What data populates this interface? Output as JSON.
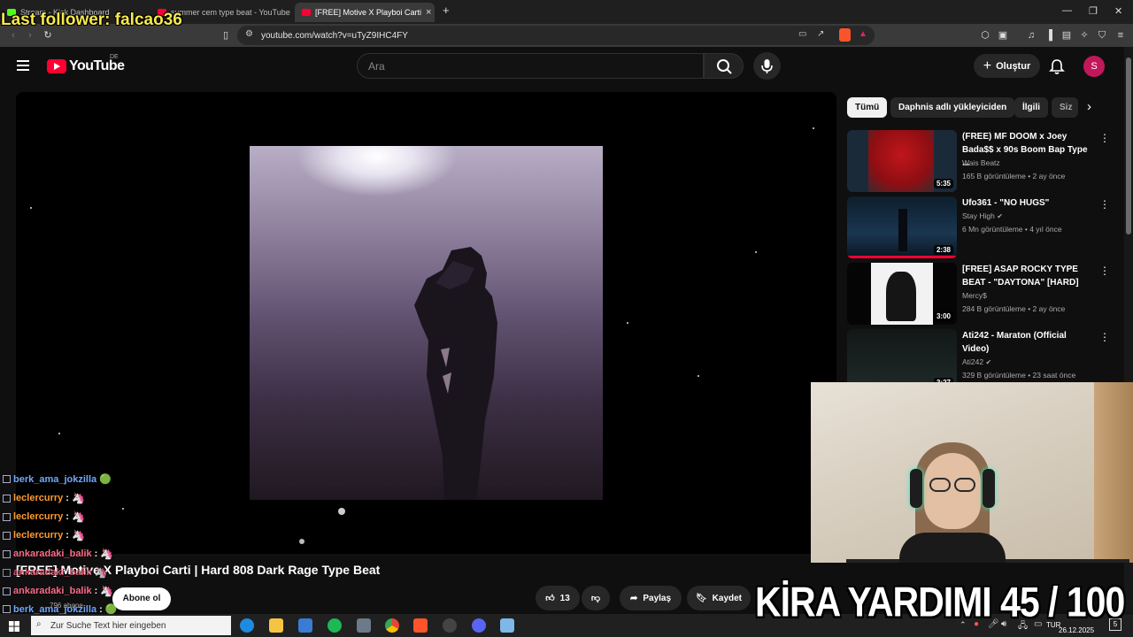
{
  "overlay": {
    "last_follower": "Last follower: falcao36",
    "goal": "KİRA YARDIMI 45 / 100"
  },
  "browser": {
    "tabs": [
      {
        "label": "Stream - Kick Dashboard",
        "color": "#53fc18"
      },
      {
        "label": "summer cem type beat - YouTube",
        "color": "#ff0033"
      },
      {
        "label": "[FREE] Motive X Playboi Carti",
        "color": "#ff0033"
      }
    ],
    "url": "youtube.com/watch?v=uTyZ9IHC4FY"
  },
  "youtube": {
    "logo_text": "YouTube",
    "country": "DE",
    "search_placeholder": "Ara",
    "create_label": "Oluştur",
    "avatar_letter": "S"
  },
  "video": {
    "title": "[FREE] Motive X Playboi Carti | Hard 808 Dark Rage Type Beat",
    "subscribe_label": "Abone ol",
    "subscriber_count": "796 abone",
    "likes": "13",
    "share_label": "Paylaş",
    "save_label": "Kaydet"
  },
  "chips": [
    "Tümü",
    "Daphnis adlı yükleyiciden",
    "İlgili",
    "Siz"
  ],
  "recommendations": [
    {
      "title": "(FREE) MF DOOM x Joey Bada$$ x 90s Boom Bap Type ...",
      "channel": "Wais Beatz",
      "meta": "165 B görüntüleme • 2 ay önce",
      "duration": "5:35",
      "verified": false
    },
    {
      "title": "Ufo361 - \"NO HUGS\"",
      "channel": "Stay High",
      "meta": "6 Mn görüntüleme • 4 yıl önce",
      "duration": "2:38",
      "verified": true
    },
    {
      "title": "[FREE] ASAP ROCKY TYPE BEAT - \"DAYTONA\" [HARD]",
      "channel": "Mercy$",
      "meta": "284 B görüntüleme • 2 ay önce",
      "duration": "3:00",
      "verified": false
    },
    {
      "title": "Ati242 - Maraton (Official Video)",
      "channel": "Ati242",
      "meta": "329 B görüntüleme • 23 saat önce",
      "duration": "3:27",
      "verified": true
    }
  ],
  "chat": [
    {
      "user": "berk_ama_jokzilla",
      "color": "#6fa8ff",
      "message": "🟢"
    },
    {
      "user": "leclercurry",
      "color": "#ff9a2e",
      "message": "🦄"
    },
    {
      "user": "leclercurry",
      "color": "#ff9a2e",
      "message": "🦄"
    },
    {
      "user": "leclercurry",
      "color": "#ff9a2e",
      "message": "🦄"
    },
    {
      "user": "ankaradaki_balik",
      "color": "#ff6b8a",
      "message": "🦄"
    },
    {
      "user": "ankaradaki_balik",
      "color": "#ff6b8a",
      "message": "🦄"
    },
    {
      "user": "ankaradaki_balik",
      "color": "#ff6b8a",
      "message": "🦄"
    },
    {
      "user": "berk_ama_jokzilla",
      "color": "#6fa8ff",
      "message": "🟢"
    }
  ],
  "taskbar": {
    "search_placeholder": "Zur Suche Text hier eingeben",
    "lang": "TUR",
    "date": "26.12.2025",
    "notifications": "5"
  }
}
